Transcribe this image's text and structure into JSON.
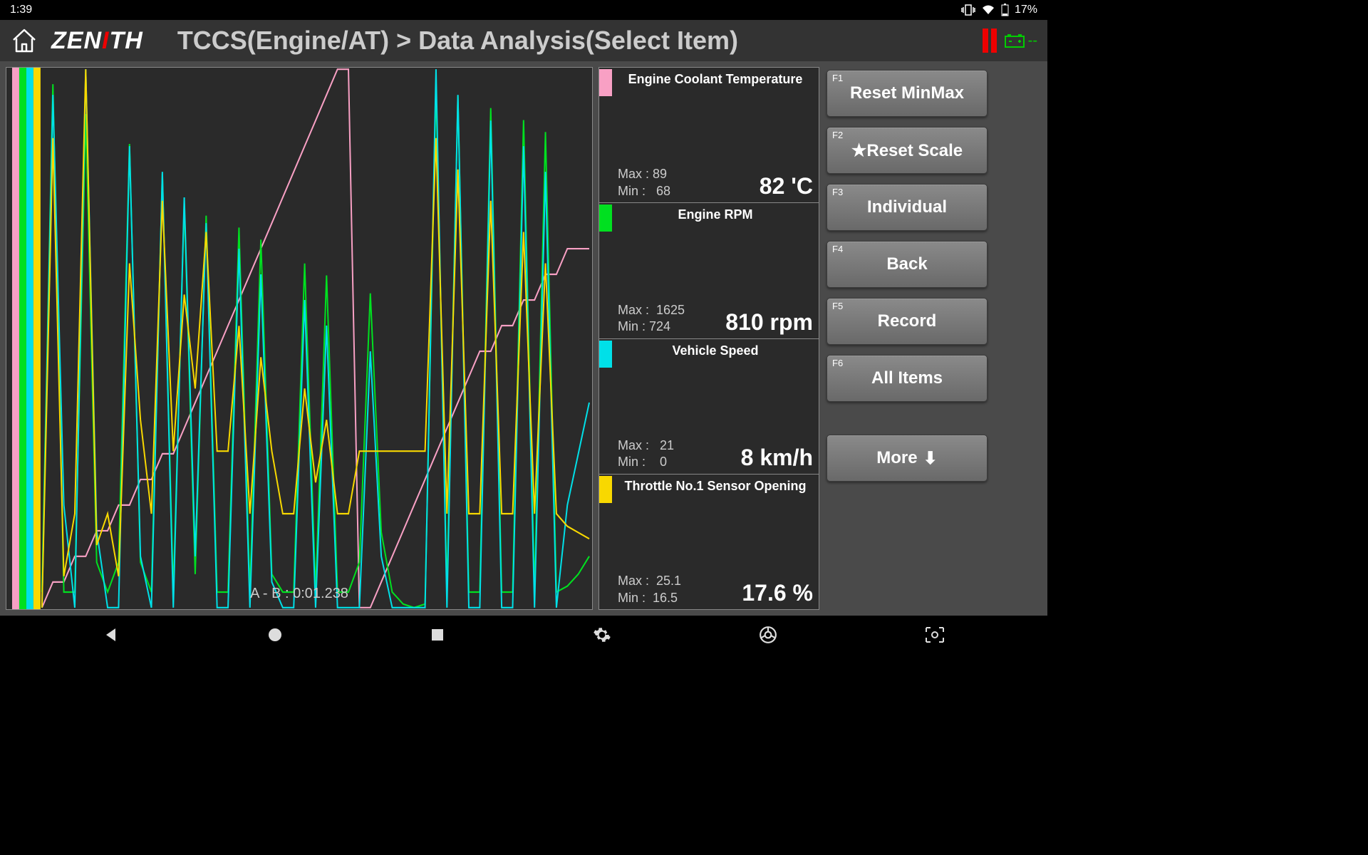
{
  "status": {
    "time": "1:39",
    "battery_pct": "17%"
  },
  "header": {
    "logo_pre": "Z",
    "logo_mid": "N",
    "logo_dot": "I",
    "logo_post": "TH",
    "logo_e": "E",
    "breadcrumb": "TCCS(Engine/AT) > Data Analysis(Select Item)",
    "batt_indicator": "--"
  },
  "chart": {
    "footer": "A - B : 0:01.238"
  },
  "params": [
    {
      "name": "Engine Coolant Temperature",
      "color": "#f8a0c4",
      "value": "82 'C",
      "max": "Max : 89",
      "min": "Min :   68"
    },
    {
      "name": "Engine RPM",
      "color": "#00e020",
      "value": "810 rpm",
      "max": "Max :  1625",
      "min": "Min : 724"
    },
    {
      "name": "Vehicle Speed",
      "color": "#00e0e8",
      "value": "8 km/h",
      "max": "Max :   21",
      "min": "Min :    0"
    },
    {
      "name": "Throttle No.1 Sensor Opening",
      "color": "#f8d800",
      "value": "17.6 %",
      "max": "Max :  25.1",
      "min": "Min :  16.5"
    }
  ],
  "buttons": [
    {
      "key": "F1",
      "label": "Reset MinMax"
    },
    {
      "key": "F2",
      "label": "★Reset Scale"
    },
    {
      "key": "F3",
      "label": "Individual"
    },
    {
      "key": "F4",
      "label": "Back"
    },
    {
      "key": "F5",
      "label": "Record"
    },
    {
      "key": "F6",
      "label": "All Items"
    }
  ],
  "more_label": "More",
  "chart_data": {
    "type": "line",
    "title": "",
    "x": [
      0,
      2,
      4,
      6,
      8,
      10,
      12,
      14,
      16,
      18,
      20,
      22,
      24,
      26,
      28,
      30,
      32,
      34,
      36,
      38,
      40,
      42,
      44,
      46,
      48,
      50,
      52,
      54,
      56,
      58,
      60,
      62,
      64,
      66,
      68,
      70,
      72,
      74,
      76,
      78,
      80,
      82,
      84,
      86,
      88,
      90,
      92,
      94,
      96,
      98,
      100
    ],
    "series": [
      {
        "name": "Engine Coolant Temperature",
        "color": "#f8a0c4",
        "values": [
          68,
          69,
          69,
          70,
          70,
          71,
          71,
          72,
          72,
          73,
          73,
          74,
          74,
          75,
          76,
          77,
          78,
          79,
          80,
          81,
          82,
          83,
          84,
          85,
          86,
          87,
          88,
          89,
          89,
          68,
          68,
          69,
          70,
          71,
          72,
          73,
          74,
          75,
          76,
          77,
          78,
          78,
          79,
          79,
          80,
          80,
          81,
          81,
          82,
          82,
          82
        ]
      },
      {
        "name": "Engine RPM",
        "color": "#00e020",
        "values": [
          750,
          1600,
          750,
          750,
          1550,
          800,
          750,
          800,
          1500,
          800,
          750,
          1450,
          750,
          1400,
          780,
          1380,
          750,
          750,
          1360,
          750,
          1340,
          780,
          750,
          750,
          1300,
          750,
          1280,
          750,
          750,
          800,
          1250,
          850,
          750,
          730,
          724,
          730,
          1600,
          750,
          1580,
          750,
          750,
          1560,
          750,
          750,
          1540,
          750,
          1520,
          750,
          760,
          780,
          810
        ]
      },
      {
        "name": "Vehicle Speed",
        "color": "#00e0e8",
        "values": [
          0,
          20,
          4,
          0,
          21,
          3,
          0,
          0,
          18,
          2,
          0,
          17,
          0,
          16,
          2,
          15,
          0,
          0,
          14,
          0,
          13,
          1,
          0,
          0,
          12,
          0,
          11,
          0,
          0,
          0,
          10,
          2,
          0,
          0,
          0,
          0,
          21,
          0,
          20,
          0,
          0,
          19,
          0,
          0,
          18,
          0,
          17,
          0,
          4,
          6,
          8
        ]
      },
      {
        "name": "Throttle No.1 Sensor Opening",
        "color": "#f8d800",
        "values": [
          16.5,
          24.0,
          17.0,
          18.0,
          25.1,
          17.5,
          18.0,
          17.0,
          22.0,
          19.5,
          18.0,
          23.0,
          19.0,
          21.5,
          20.0,
          22.5,
          19.0,
          19.0,
          21.0,
          18.0,
          20.5,
          19.0,
          18.0,
          18.0,
          20.0,
          18.5,
          19.5,
          18.0,
          18.0,
          19.0,
          19.0,
          19.0,
          19.0,
          19.0,
          19.0,
          19.0,
          24.0,
          18.0,
          23.5,
          18.0,
          18.0,
          23.0,
          18.0,
          18.0,
          22.5,
          18.0,
          22.0,
          18.0,
          17.8,
          17.7,
          17.6
        ]
      }
    ],
    "ranges": {
      "Engine Coolant Temperature": [
        68,
        89
      ],
      "Engine RPM": [
        724,
        1625
      ],
      "Vehicle Speed": [
        0,
        21
      ],
      "Throttle No.1 Sensor Opening": [
        16.5,
        25.1
      ]
    }
  }
}
